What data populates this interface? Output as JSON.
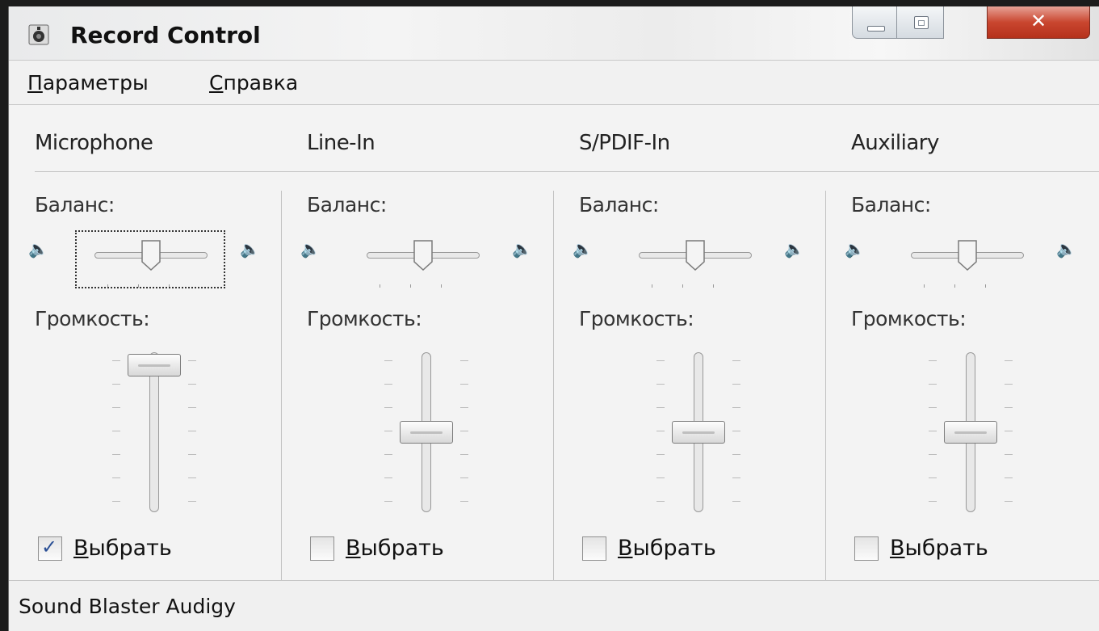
{
  "window": {
    "title": "Record Control",
    "close_glyph": "✕",
    "icon": "speaker-app-icon"
  },
  "menu": {
    "items": [
      "Параметры",
      "Справка"
    ]
  },
  "channels": [
    {
      "name": "Microphone",
      "balance_label": "Баланс:",
      "volume_label": "Громкость:",
      "select_label": "Выбрать",
      "selected": true,
      "balance": 0.5,
      "volume": 1.0,
      "focused": true
    },
    {
      "name": "Line-In",
      "balance_label": "Баланс:",
      "volume_label": "Громкость:",
      "select_label": "Выбрать",
      "selected": false,
      "balance": 0.5,
      "volume": 0.5,
      "focused": false
    },
    {
      "name": "S/PDIF-In",
      "balance_label": "Баланс:",
      "volume_label": "Громкость:",
      "select_label": "Выбрать",
      "selected": false,
      "balance": 0.5,
      "volume": 0.5,
      "focused": false
    },
    {
      "name": "Auxiliary",
      "balance_label": "Баланс:",
      "volume_label": "Громкость:",
      "select_label": "Выбрать",
      "selected": false,
      "balance": 0.5,
      "volume": 0.5,
      "focused": false
    }
  ],
  "check_glyph": "✓",
  "speaker_glyph": "🔈",
  "status": {
    "text": "Sound Blaster Audigy"
  },
  "colors": {
    "close_button": "#c9462f",
    "check_accent": "#2a4f95"
  }
}
